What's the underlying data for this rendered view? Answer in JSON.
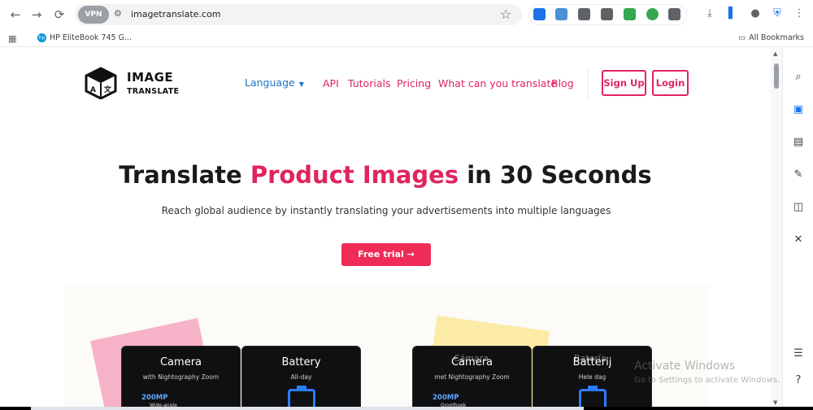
{
  "browser": {
    "url": "imagetranslate.com",
    "vpn_label": "VPN",
    "bookmark": "HP EliteBook 745 G...",
    "all_bookmarks": "All Bookmarks"
  },
  "header": {
    "logo_line1": "IMAGE",
    "logo_line2": "TRANSLATE",
    "logo_cube_letters": [
      "A",
      "文"
    ],
    "nav": {
      "language": "Language",
      "api": "API",
      "tutorials": "Tutorials",
      "pricing": "Pricing",
      "what": "What can you translate",
      "blog": "Blog"
    },
    "signup": "Sign Up",
    "login": "Login"
  },
  "hero": {
    "title_before": "Translate ",
    "title_accent": "Product Images",
    "title_after": " in 30 Seconds",
    "subtitle": "Reach global audience by instantly translating your advertisements into multiple languages",
    "cta_label": "Free trial",
    "cta_arrow": "→"
  },
  "cards": {
    "left_camera": {
      "title": "Camera",
      "sub": "with Nightography Zoom",
      "spec": "200MP",
      "spec2": "Wide-angle"
    },
    "left_battery": {
      "title": "Battery",
      "sub": "All-day"
    },
    "right_camera": {
      "title": "Camera",
      "ghost_title": "Cámara",
      "sub": "met Nightography Zoom",
      "spec": "200MP",
      "spec2": "Groothoek"
    },
    "right_battery": {
      "title": "Batterij",
      "ghost_title": "Batería",
      "sub": "Hele dag"
    }
  },
  "watermark": {
    "line1": "Activate Windows",
    "line2": "Go to Settings to activate Windows."
  },
  "colors": {
    "accent": "#e0245e",
    "link_blue": "#1a73c8",
    "cta": "#ef2b57"
  }
}
